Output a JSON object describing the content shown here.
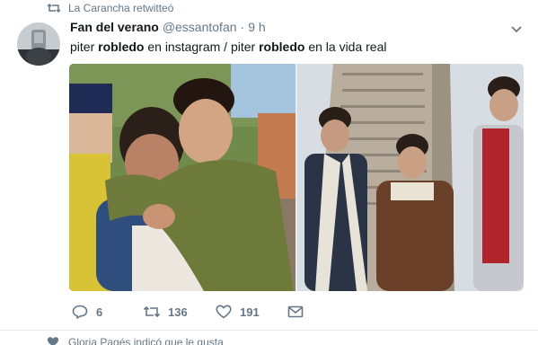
{
  "retweet_context": {
    "text": "La Carancha retwitteó"
  },
  "tweet": {
    "author_name": "Fan del verano",
    "author_handle": "@essantofan",
    "separator": "·",
    "time": "9 h",
    "text_parts": [
      "piter ",
      "robledo",
      " en instagram / piter ",
      "robledo",
      " en la vida real"
    ],
    "stats": {
      "replies": "6",
      "retweets": "136",
      "likes": "191"
    }
  },
  "next_context": {
    "text": "Gloria Pagés indicó que le gusta"
  },
  "icons": {
    "retweet_context": "retweet-icon",
    "caret": "chevron-down-icon",
    "reply": "reply-icon",
    "retweet": "retweet-icon",
    "like": "heart-icon",
    "dm": "envelope-icon",
    "like_context": "heart-icon"
  },
  "colors": {
    "secondary_text": "#657786",
    "primary_text": "#14171a",
    "divider": "#e6ecf0"
  }
}
